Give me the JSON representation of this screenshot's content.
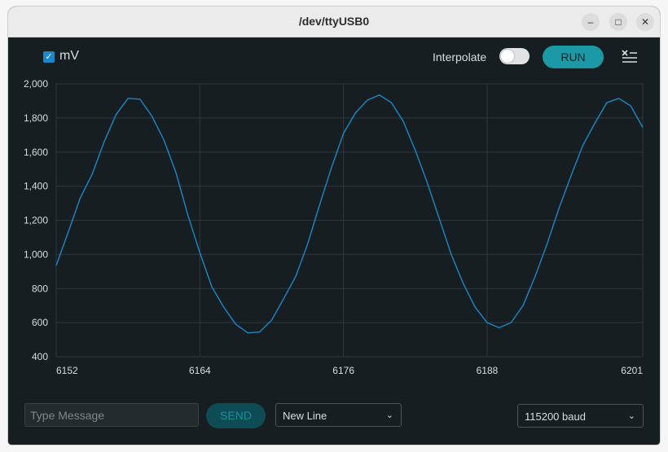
{
  "window": {
    "title": "/dev/ttyUSB0",
    "min_icon": "minimize-icon",
    "max_icon": "maximize-icon",
    "close_icon": "close-icon"
  },
  "toolbar": {
    "series_label": "mV",
    "series_checked": true,
    "interpolate_label": "Interpolate",
    "interpolate_on": false,
    "run_label": "RUN",
    "clear_icon": "clear-list-icon"
  },
  "colors": {
    "background": "#171e21",
    "series": "#1b87c9",
    "accent": "#1b9aa5",
    "grid": "#2e393e"
  },
  "footer": {
    "message_placeholder": "Type Message",
    "send_label": "SEND",
    "line_ending": "New Line",
    "baud_rate": "115200 baud"
  },
  "chart_data": {
    "type": "line",
    "series": [
      {
        "name": "mV",
        "x": [
          6152,
          6153,
          6154,
          6155,
          6156,
          6157,
          6158,
          6159,
          6160,
          6161,
          6162,
          6163,
          6164,
          6165,
          6166,
          6167,
          6168,
          6169,
          6170,
          6171,
          6172,
          6173,
          6174,
          6175,
          6176,
          6177,
          6178,
          6179,
          6180,
          6181,
          6182,
          6183,
          6184,
          6185,
          6186,
          6187,
          6188,
          6189,
          6190,
          6191,
          6192,
          6193,
          6194,
          6195,
          6196,
          6197,
          6198,
          6199,
          6200,
          6201
        ],
        "values": [
          935,
          1130,
          1330,
          1470,
          1660,
          1820,
          1915,
          1910,
          1810,
          1670,
          1480,
          1230,
          1010,
          810,
          690,
          590,
          540,
          545,
          615,
          740,
          870,
          1060,
          1290,
          1510,
          1710,
          1830,
          1905,
          1935,
          1890,
          1780,
          1610,
          1420,
          1210,
          1000,
          830,
          690,
          600,
          570,
          600,
          700,
          870,
          1060,
          1270,
          1460,
          1640,
          1770,
          1890,
          1915,
          1870,
          1745
        ]
      }
    ],
    "xlim": [
      6152,
      6201
    ],
    "ylim": [
      400,
      2000
    ],
    "x_ticks": [
      "6152",
      "6164",
      "6176",
      "6188",
      "6201"
    ],
    "x_tick_values": [
      6152,
      6164,
      6176,
      6188,
      6201
    ],
    "y_ticks": [
      "2,000",
      "1,800",
      "1,600",
      "1,400",
      "1,200",
      "1,000",
      "800",
      "600",
      "400"
    ],
    "y_tick_values": [
      2000,
      1800,
      1600,
      1400,
      1200,
      1000,
      800,
      600,
      400
    ],
    "grid": true,
    "legend": "top-left"
  }
}
